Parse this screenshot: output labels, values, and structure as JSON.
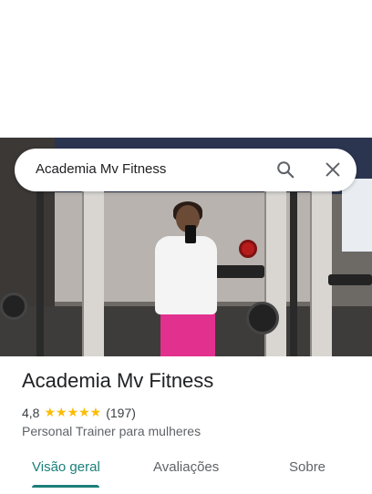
{
  "search": {
    "query": "Academia Mv Fitness"
  },
  "place": {
    "name": "Academia Mv Fitness",
    "rating": "4,8",
    "stars": "★★★★★",
    "reviews": "(197)",
    "category": "Personal Trainer para mulheres"
  },
  "tabs": [
    {
      "label": "Visão geral",
      "active": true
    },
    {
      "label": "Avaliações",
      "active": false
    },
    {
      "label": "Sobre",
      "active": false
    }
  ],
  "colors": {
    "accent": "#1a7f78",
    "star": "#fbbc04",
    "pants": "#e2308f"
  }
}
